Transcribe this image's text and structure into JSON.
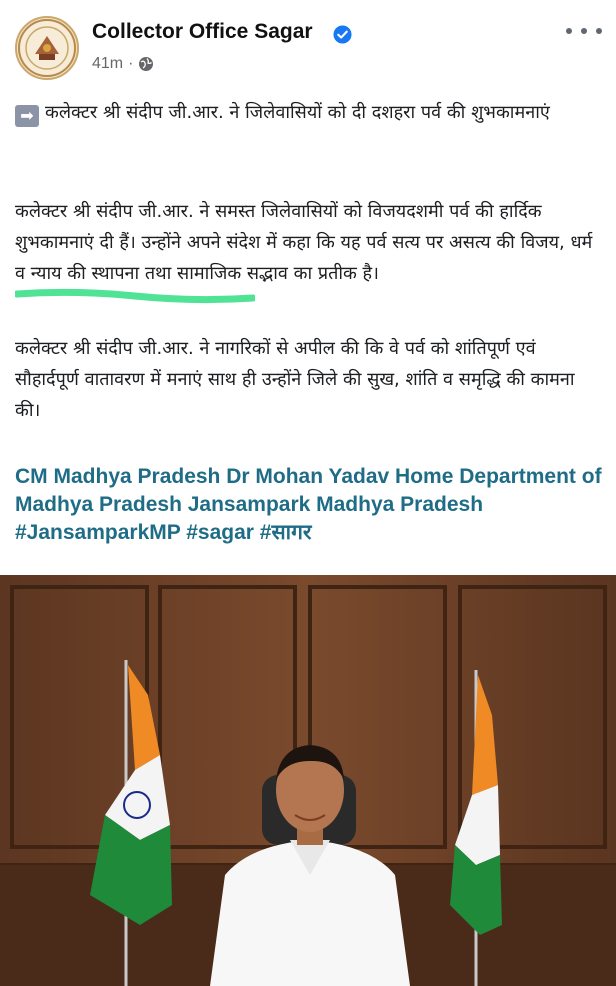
{
  "post": {
    "page_name": "Collector Office Sagar",
    "time": "41m",
    "separator": "·",
    "headline": "कलेक्टर श्री संदीप जी.आर. ने जिलेवासियों को दी दशहरा पर्व की शुभकामनाएं",
    "para1": "कलेक्टर श्री संदीप जी.आर. ने समस्त जिलेवासियों को विजयदशमी पर्व की हार्दिक शुभकामनाएं दी हैं। उन्होंने अपने संदेश में कहा कि यह पर्व सत्य पर असत्य की विजय, धर्म व न्याय की स्थापना तथा सामाजिक सद्भाव का प्रतीक है।",
    "para2": "कलेक्टर श्री संदीप जी.आर. ने नागरिकों से अपील की कि वे पर्व को शांतिपूर्ण एवं सौहार्दपूर्ण वातावरण में मनाएं साथ ही उन्होंने जिले की सुख, शांति व समृद्धि की कामना की।",
    "tags": "CM Madhya Pradesh Dr Mohan Yadav Home Department of Madhya Pradesh Jansampark Madhya Pradesh #JansamparkMP #sagar #सागर"
  },
  "icons": {
    "verified": "verified-badge-icon",
    "privacy": "globe-icon",
    "more": "more-options-icon",
    "headline_prefix": "right-arrow-emoji-icon"
  },
  "colors": {
    "verified_blue": "#1877f2",
    "link_teal": "#1f6c87",
    "highlight_green": "#3ee08a",
    "meta_gray": "#65676b"
  }
}
